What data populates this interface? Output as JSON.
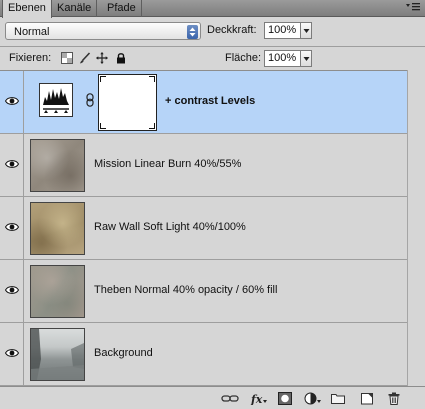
{
  "tabs": [
    {
      "label": "Ebenen",
      "active": true
    },
    {
      "label": "Kanäle",
      "active": false
    },
    {
      "label": "Pfade",
      "active": false
    }
  ],
  "blend": {
    "mode": "Normal",
    "opacity_label": "Deckkraft:",
    "opacity_value": "100%"
  },
  "lock": {
    "label": "Fixieren:",
    "fill_label": "Fläche:",
    "fill_value": "100%"
  },
  "layers": [
    {
      "name": "+ contrast Levels",
      "type": "adjustment",
      "selected": true,
      "visible": true,
      "bold": true
    },
    {
      "name": "Mission Linear Burn 40%/55%",
      "type": "texture",
      "selected": false,
      "visible": true
    },
    {
      "name": "Raw Wall Soft Light 40%/100%",
      "type": "texture",
      "selected": false,
      "visible": true
    },
    {
      "name": "Theben Normal 40% opacity / 60% fill",
      "type": "texture",
      "selected": false,
      "visible": true
    },
    {
      "name": "Background",
      "type": "photo",
      "selected": false,
      "visible": true
    }
  ],
  "bottom_icons": [
    "link-layers-icon",
    "fx-icon",
    "mask-icon",
    "adjustment-layer-icon",
    "group-folder-icon",
    "new-layer-icon",
    "trash-icon"
  ],
  "colors": {
    "selection": "#b6d4f8",
    "panel_bg": "#d6d6d6"
  }
}
